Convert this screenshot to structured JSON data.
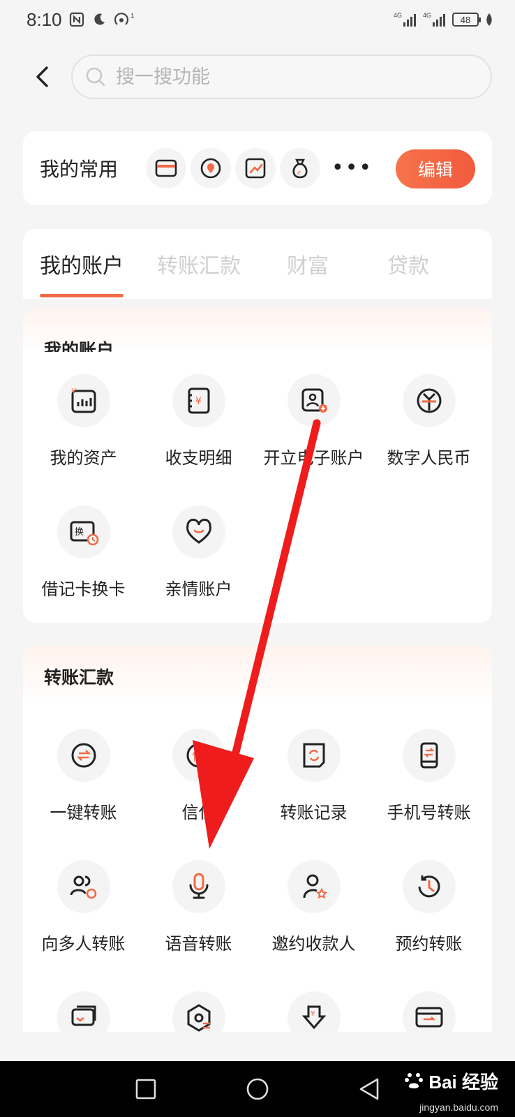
{
  "status_bar": {
    "time": "8:10",
    "battery": "48",
    "network": "4G"
  },
  "header": {
    "search_placeholder": "搜一搜功能"
  },
  "favorites": {
    "title": "我的常用",
    "icons": [
      "wallet-icon",
      "location-icon",
      "chart-icon",
      "money-bag-icon"
    ],
    "more": "•••",
    "edit_label": "编辑"
  },
  "tabs": [
    {
      "label": "我的账户",
      "active": true
    },
    {
      "label": "转账汇款",
      "active": false
    },
    {
      "label": "财富",
      "active": false
    },
    {
      "label": "贷款",
      "active": false
    }
  ],
  "section_accounts": {
    "title": "我的账户",
    "items": [
      {
        "label": "我的资产",
        "icon": "assets-chart-icon"
      },
      {
        "label": "收支明细",
        "icon": "statement-icon"
      },
      {
        "label": "开立电子账户",
        "icon": "open-account-icon"
      },
      {
        "label": "数字人民币",
        "icon": "digital-rmb-icon"
      },
      {
        "label": "借记卡换卡",
        "icon": "card-swap-icon"
      },
      {
        "label": "亲情账户",
        "icon": "heart-icon"
      }
    ]
  },
  "section_transfer": {
    "title": "转账汇款",
    "items": [
      {
        "label": "一键转账",
        "icon": "one-click-transfer-icon"
      },
      {
        "label": "信任",
        "icon": "trust-icon"
      },
      {
        "label": "转账记录",
        "icon": "transfer-record-icon"
      },
      {
        "label": "手机号转账",
        "icon": "phone-transfer-icon"
      },
      {
        "label": "向多人转账",
        "icon": "multi-person-transfer-icon"
      },
      {
        "label": "语音转账",
        "icon": "microphone-icon"
      },
      {
        "label": "邀约收款人",
        "icon": "invite-payee-icon"
      },
      {
        "label": "预约转账",
        "icon": "scheduled-transfer-icon"
      }
    ]
  },
  "watermark": {
    "logo": "Bai 经验",
    "sub": "jingyan.baidu.com"
  },
  "colors": {
    "accent": "#f06a45",
    "arrow": "#ee1c1c"
  }
}
